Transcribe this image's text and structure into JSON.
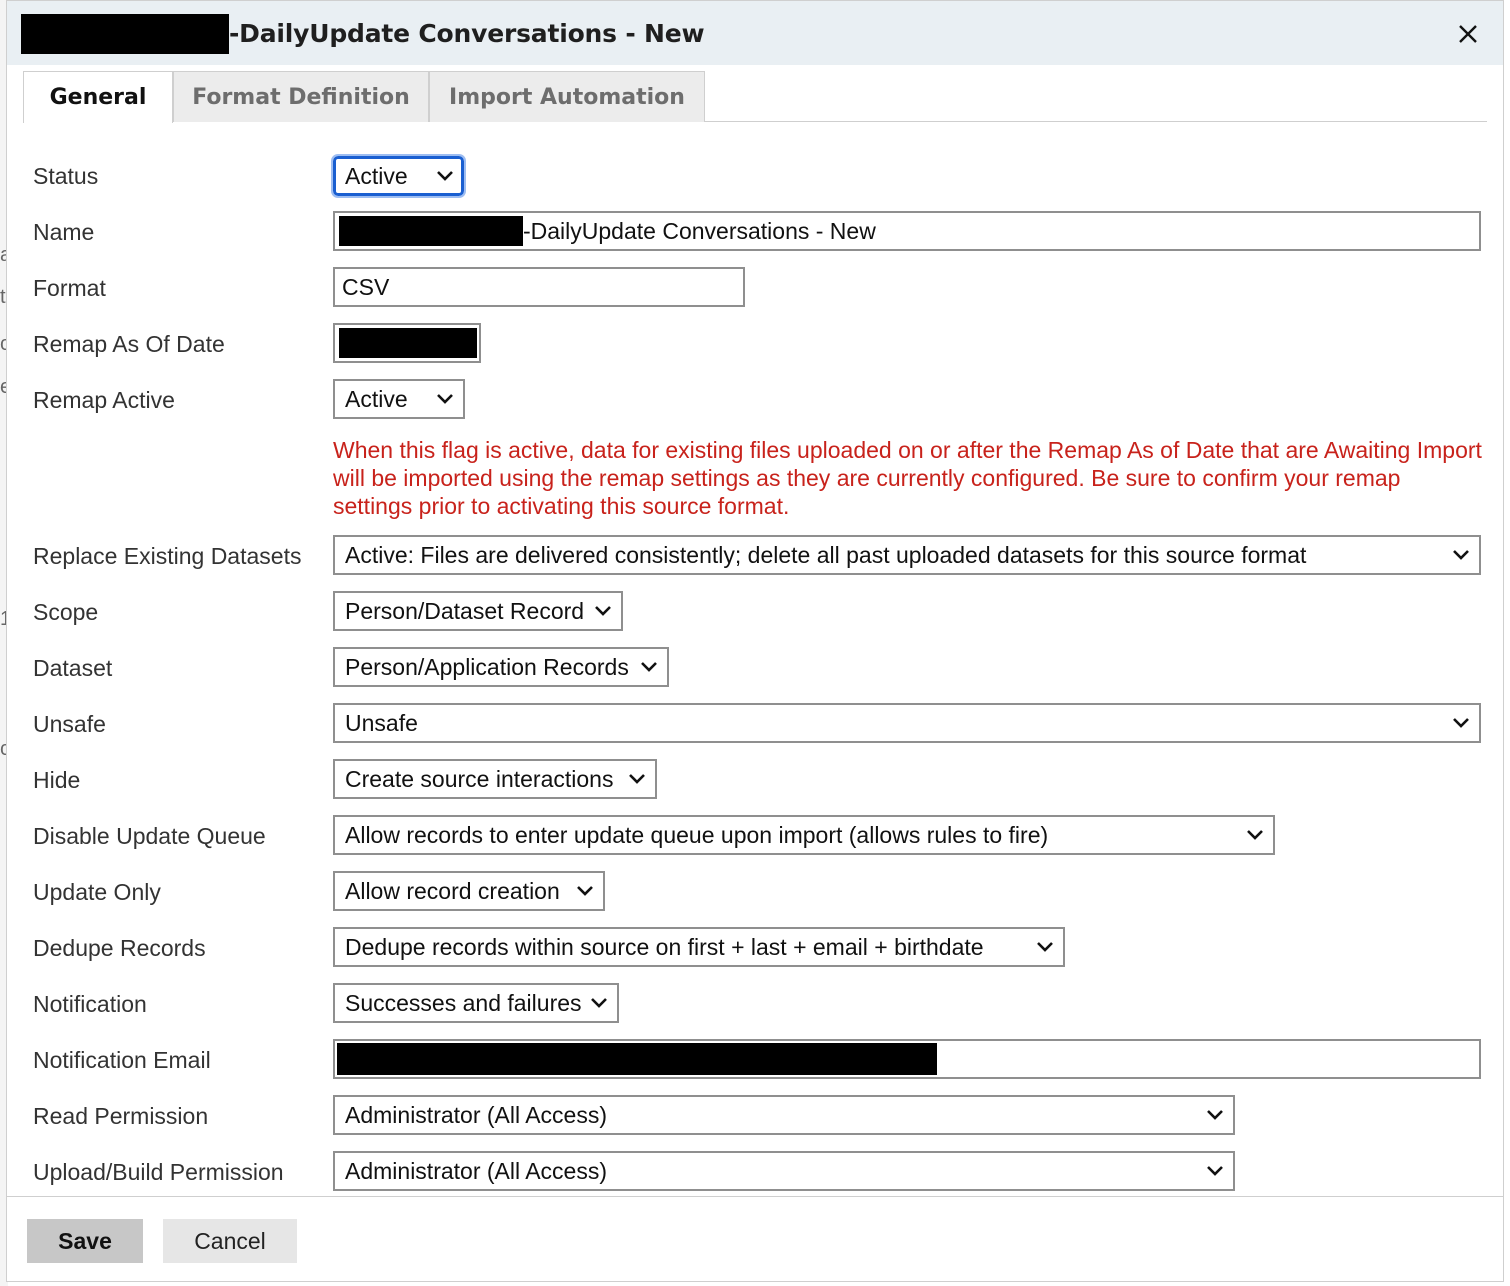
{
  "dialog": {
    "title": "-DailyUpdate Conversations - New",
    "close_label": "×"
  },
  "tabs": [
    {
      "label": "General",
      "active": true
    },
    {
      "label": "Format Definition",
      "active": false
    },
    {
      "label": "Import Automation",
      "active": false
    }
  ],
  "form": {
    "status": {
      "label": "Status",
      "value": "Active"
    },
    "name": {
      "label": "Name",
      "value": "-DailyUpdate Conversations - New"
    },
    "format": {
      "label": "Format",
      "value": "CSV"
    },
    "remap_as_of_date": {
      "label": "Remap As Of Date"
    },
    "remap_active": {
      "label": "Remap Active",
      "value": "Active"
    },
    "warning": "When this flag is active, data for existing files uploaded on or after the Remap As of Date that are Awaiting Import will be imported using the remap settings as they are currently configured. Be sure to confirm your remap settings prior to activating this source format.",
    "replace_existing": {
      "label": "Replace Existing Datasets",
      "value": "Active: Files are delivered consistently; delete all past uploaded datasets for this source format"
    },
    "scope": {
      "label": "Scope",
      "value": "Person/Dataset Record"
    },
    "dataset": {
      "label": "Dataset",
      "value": "Person/Application Records"
    },
    "unsafe": {
      "label": "Unsafe",
      "value": "Unsafe"
    },
    "hide": {
      "label": "Hide",
      "value": "Create source interactions"
    },
    "disable_update_queue": {
      "label": "Disable Update Queue",
      "value": "Allow records to enter update queue upon import (allows rules to fire)"
    },
    "update_only": {
      "label": "Update Only",
      "value": "Allow record creation"
    },
    "dedupe_records": {
      "label": "Dedupe Records",
      "value": "Dedupe records within source on first + last + email + birthdate"
    },
    "notification": {
      "label": "Notification",
      "value": "Successes and failures"
    },
    "notification_email": {
      "label": "Notification Email"
    },
    "read_permission": {
      "label": "Read Permission",
      "value": "Administrator (All Access)"
    },
    "upload_permission": {
      "label": "Upload/Build Permission",
      "value": "Administrator (All Access)"
    }
  },
  "footer": {
    "save_label": "Save",
    "cancel_label": "Cancel"
  },
  "background_text": [
    "a",
    "t",
    "c",
    "e",
    "1",
    "c"
  ],
  "colors": {
    "title_bar": "#e9eff3",
    "warning_text": "#c8221b",
    "focus_border": "#1a5fd1"
  }
}
